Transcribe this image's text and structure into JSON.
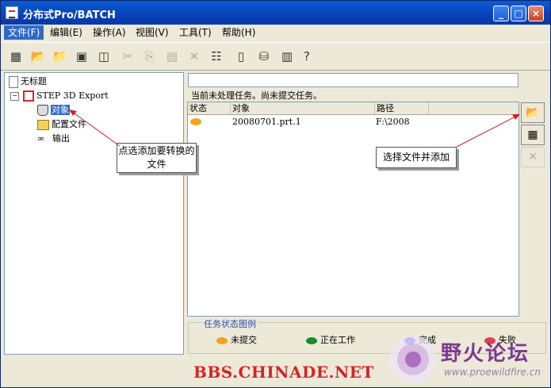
{
  "window": {
    "title": "分布式Pro/BATCH"
  },
  "menu": [
    "文件(F)",
    "编辑(E)",
    "操作(A)",
    "视图(V)",
    "工具(T)",
    "帮助(H)"
  ],
  "toolbar": [
    "new-project-icon",
    "open-icon",
    "open-folder-icon",
    "save-icon",
    "save-all-icon",
    "cut-icon",
    "copy-icon",
    "paste-icon",
    "delete-icon",
    "properties-icon",
    "document-icon",
    "database-icon",
    "help-icon"
  ],
  "tree": {
    "root": "无标题",
    "task": "STEP 3D Export",
    "children": [
      "对象",
      "配置文件",
      "输出"
    ]
  },
  "status": {
    "text": "当前未处理任务。尚未提交任务。"
  },
  "table": {
    "headers": [
      "状态",
      "对象",
      "路径"
    ],
    "rows": [
      {
        "object": "20080701.prt.1",
        "path": "F:\\2008"
      }
    ]
  },
  "legend": {
    "title": "任务状态图例",
    "items": [
      {
        "label": "未提交",
        "color": "#f5a020"
      },
      {
        "label": "正在工作",
        "color": "#1a8a2a"
      },
      {
        "label": "完成",
        "color": "#6060e8"
      },
      {
        "label": "失败",
        "color": "#e04050"
      }
    ]
  },
  "callouts": {
    "left": "点选添加要转换的文件",
    "right": "选择文件并添加"
  },
  "watermark": {
    "url_text": "BBS.CHINADE.NET",
    "logo_title": "野火论坛",
    "logo_url": "www.proewildfire.cn"
  },
  "colors": {
    "title_bar": "#0842b8",
    "selection": "#316ac5",
    "watermark": "#d62424"
  }
}
